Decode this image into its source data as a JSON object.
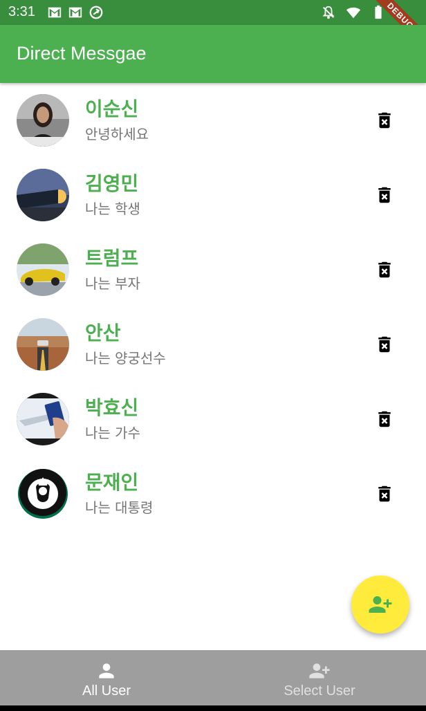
{
  "status_bar": {
    "time": "3:31",
    "left_icons": [
      "gmail-icon",
      "gmail-icon",
      "sync-icon"
    ],
    "right_icons": [
      "bell-off-icon",
      "wifi-icon",
      "battery-icon"
    ],
    "debug_label": "DEBUG"
  },
  "app_bar": {
    "title": "Direct Messgae",
    "color": "#4caf50"
  },
  "users": [
    {
      "name": "이순신",
      "message": "안녕하세요",
      "avatar": "woman-photo"
    },
    {
      "name": "김영민",
      "message": "나는 학생",
      "avatar": "truck-sunset-photo"
    },
    {
      "name": "트럼프",
      "message": "나는 부자",
      "avatar": "yellow-car-photo"
    },
    {
      "name": "안산",
      "message": "나는 양궁선수",
      "avatar": "road-car-photo"
    },
    {
      "name": "박효신",
      "message": "나는 가수",
      "avatar": "plane-passport-photo"
    },
    {
      "name": "문재인",
      "message": "나는 대통령",
      "avatar": "starbucks-logo"
    }
  ],
  "fab": {
    "icon": "person-add-icon",
    "color": "#ffeb3b"
  },
  "bottom_nav": {
    "items": [
      {
        "label": "All User",
        "icon": "person-icon",
        "selected": true
      },
      {
        "label": "Select User",
        "icon": "person-add-icon",
        "selected": false
      }
    ]
  }
}
